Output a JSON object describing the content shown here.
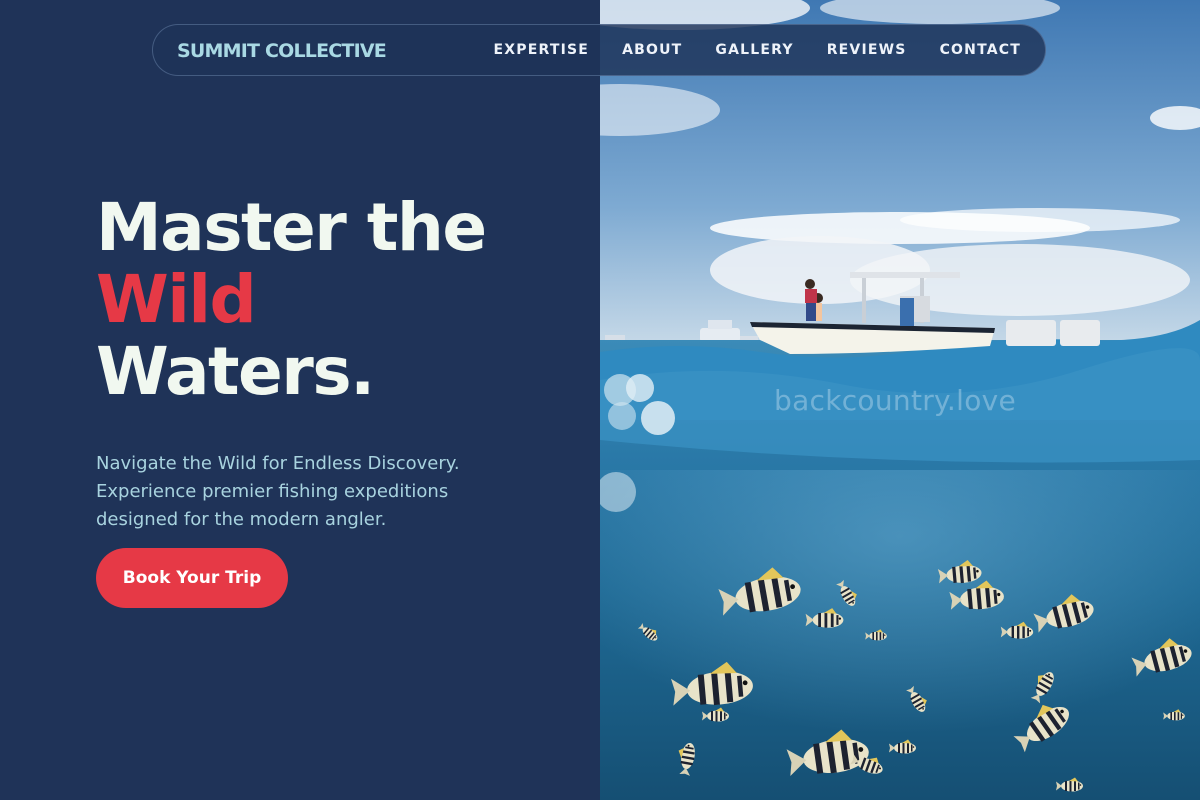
{
  "brand": {
    "name": "SUMMIT COLLECTIVE"
  },
  "nav": {
    "items": [
      {
        "label": "EXPERTISE"
      },
      {
        "label": "ABOUT"
      },
      {
        "label": "GALLERY"
      },
      {
        "label": "REVIEWS"
      },
      {
        "label": "CONTACT"
      }
    ]
  },
  "hero": {
    "headline_line1": "Master the",
    "headline_accent": "Wild",
    "headline_line3": "Waters.",
    "subtitle_line1": "Navigate the Wild for Endless Discovery.",
    "subtitle_line2": "Experience premier fishing expeditions",
    "subtitle_line3": "designed for the modern angler.",
    "cta_label": "Book Your Trip"
  },
  "photo": {
    "watermark": "backcountry.love"
  },
  "colors": {
    "panel": "#1f3358",
    "accent": "#e63946",
    "headline": "#f1f8f0",
    "brand": "#a9d9e4",
    "subtitle": "#a8d3df"
  }
}
